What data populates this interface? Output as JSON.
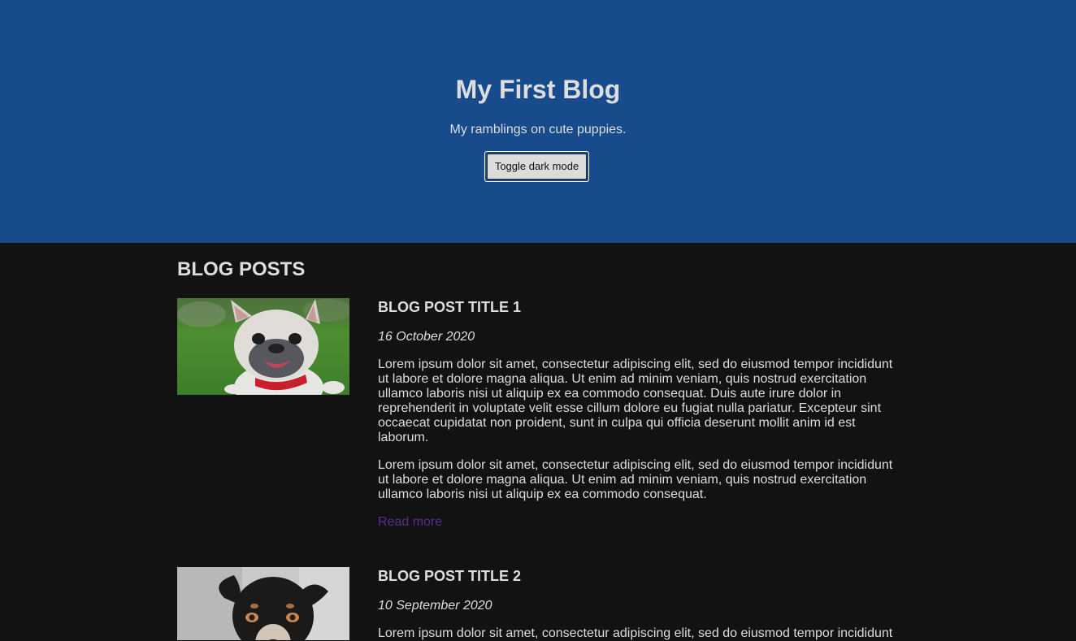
{
  "header": {
    "title": "My First Blog",
    "tagline": "My ramblings on cute puppies.",
    "toggle_label": "Toggle dark mode"
  },
  "main": {
    "section_title": "BLOG POSTS",
    "posts": [
      {
        "title": "BLOG POST TITLE 1",
        "date": "16 October 2020",
        "paragraph1": "Lorem ipsum dolor sit amet, consectetur adipiscing elit, sed do eiusmod tempor incididunt ut labore et dolore magna aliqua. Ut enim ad minim veniam, quis nostrud exercitation ullamco laboris nisi ut aliquip ex ea commodo consequat. Duis aute irure dolor in reprehenderit in voluptate velit esse cillum dolore eu fugiat nulla pariatur. Excepteur sint occaecat cupidatat non proident, sunt in culpa qui officia deserunt mollit anim id est laborum.",
        "paragraph2": "Lorem ipsum dolor sit amet, consectetur adipiscing elit, sed do eiusmod tempor incididunt ut labore et dolore magna aliqua. Ut enim ad minim veniam, quis nostrud exercitation ullamco laboris nisi ut aliquip ex ea commodo consequat.",
        "read_more": "Read more"
      },
      {
        "title": "BLOG POST TITLE 2",
        "date": "10 September 2020",
        "paragraph1": "Lorem ipsum dolor sit amet, consectetur adipiscing elit, sed do eiusmod tempor incididunt"
      }
    ]
  },
  "colors": {
    "hero_background": "#174b8c",
    "page_background": "#121212",
    "text": "#dddddd",
    "link": "#5b2b91"
  }
}
